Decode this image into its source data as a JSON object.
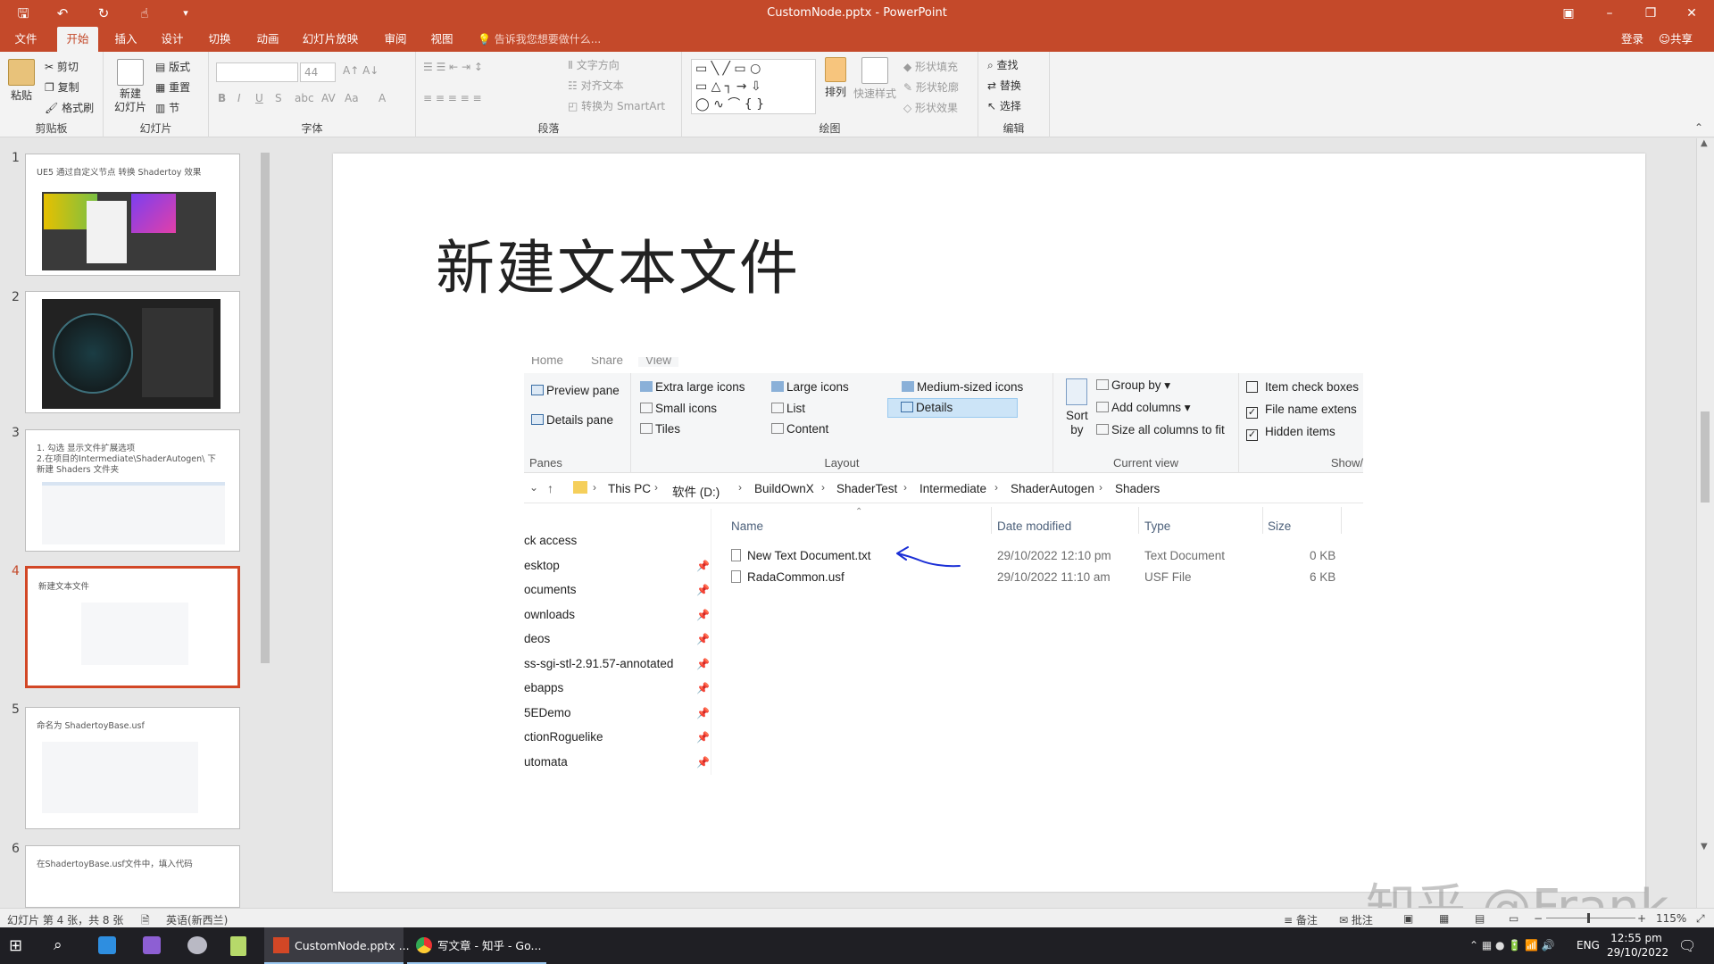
{
  "window": {
    "title": "CustomNode.pptx - PowerPoint"
  },
  "tabs": [
    {
      "label": "文件"
    },
    {
      "label": "开始"
    },
    {
      "label": "插入"
    },
    {
      "label": "设计"
    },
    {
      "label": "切换"
    },
    {
      "label": "动画"
    },
    {
      "label": "幻灯片放映"
    },
    {
      "label": "审阅"
    },
    {
      "label": "视图"
    }
  ],
  "tell_me": "告诉我您想要做什么...",
  "account": {
    "login": "登录",
    "share": "共享"
  },
  "ribbon": {
    "clipboard": {
      "paste": "粘贴",
      "cut": "剪切",
      "copy": "复制",
      "format_painter": "格式刷",
      "label": "剪贴板"
    },
    "slides": {
      "new_slide_1": "新建",
      "new_slide_2": "幻灯片",
      "layout": "版式",
      "reset": "重置",
      "section": "节",
      "label": "幻灯片"
    },
    "font": {
      "font_size": "44",
      "label": "字体"
    },
    "paragraph": {
      "text_direction": "文字方向",
      "align_text": "对齐文本",
      "smartart": "转换为 SmartArt",
      "label": "段落"
    },
    "drawing": {
      "arrange": "排列",
      "quick_styles": "快速样式",
      "shape_fill": "形状填充",
      "shape_outline": "形状轮廓",
      "shape_effects": "形状效果",
      "label": "绘图"
    },
    "editing": {
      "find": "查找",
      "replace": "替换",
      "select": "选择",
      "label": "编辑"
    }
  },
  "thumbnails": [
    {
      "num": "1",
      "text": "UE5 通过自定义节点 转换 Shadertoy 效果"
    },
    {
      "num": "2",
      "text": ""
    },
    {
      "num": "3",
      "text": "1. 勾选 显示文件扩展选项"
    },
    {
      "num": "4",
      "text": "新建文本文件"
    },
    {
      "num": "5",
      "text": "命名为 ShadertoyBase.usf"
    },
    {
      "num": "6",
      "text": "在ShadertoyBase.usf文件中，填入代码"
    }
  ],
  "thumb3_line2": "2.在项目的Intermediate\\ShaderAutogen\\ 下",
  "thumb3_line3": "新建 Shaders 文件夹",
  "slide": {
    "title": "新建文本文件"
  },
  "explorer": {
    "tabs": [
      "Home",
      "Share",
      "View"
    ],
    "panes": {
      "preview": "Preview pane",
      "details": "Details pane",
      "label": "Panes"
    },
    "layout": {
      "items": [
        "Extra large icons",
        "Large icons",
        "Medium-sized icons",
        "Small icons",
        "List",
        "Details",
        "Tiles",
        "Content"
      ],
      "label": "Layout"
    },
    "current_view": {
      "sort_1": "Sort",
      "sort_2": "by",
      "group_by": "Group by",
      "add_columns": "Add columns",
      "size_cols": "Size all columns to fit",
      "label": "Current view"
    },
    "show": {
      "item_check": "Item check boxes",
      "file_ext": "File name extens",
      "hidden": "Hidden items",
      "label": "Show/"
    },
    "path": [
      "This PC",
      "软件 (D:)",
      "BuildOwnX",
      "ShaderTest",
      "Intermediate",
      "ShaderAutogen",
      "Shaders"
    ],
    "nav": [
      "ck access",
      "esktop",
      "ocuments",
      "ownloads",
      "deos",
      "ss-sgi-stl-2.91.57-annotated",
      "ebapps",
      "5EDemo",
      "ctionRoguelike",
      "utomata"
    ],
    "columns": [
      "Name",
      "Date modified",
      "Type",
      "Size"
    ],
    "files": [
      {
        "name": "New Text Document.txt",
        "date": "29/10/2022 12:10 pm",
        "type": "Text Document",
        "size": "0 KB"
      },
      {
        "name": "RadaCommon.usf",
        "date": "29/10/2022 11:10 am",
        "type": "USF File",
        "size": "6 KB"
      }
    ]
  },
  "status": {
    "slide_info": "幻灯片 第 4 张，共 8 张",
    "language": "英语(新西兰)",
    "notes": "备注",
    "comments": "批注",
    "zoom": "115%"
  },
  "taskbar": {
    "apps": [
      "CustomNode.pptx ...",
      "写文章 - 知乎 - Go..."
    ],
    "lang": "ENG",
    "time": "12:55 pm",
    "date": "29/10/2022"
  },
  "watermark": "知乎 @Frank",
  "colors": {
    "accent": "#c4492a",
    "selection": "#cce4f7",
    "annotation": "#1b2fd6"
  }
}
